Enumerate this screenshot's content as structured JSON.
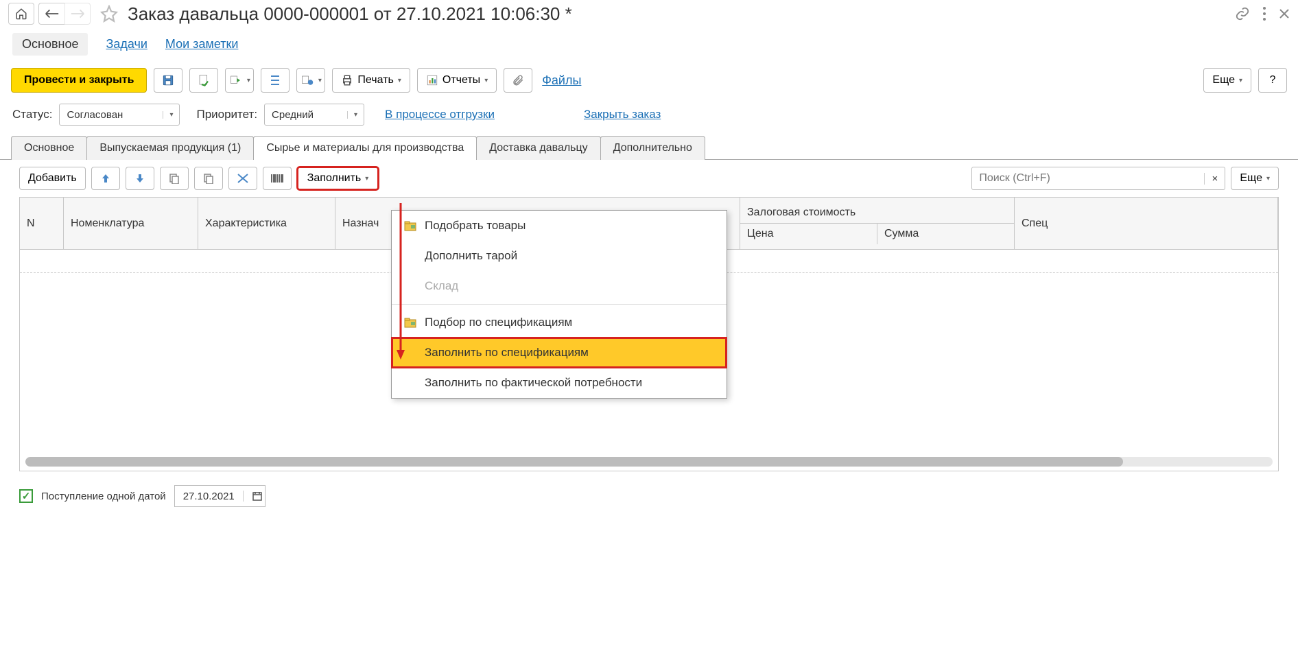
{
  "window": {
    "title": "Заказ давальца 0000-000001 от 27.10.2021 10:06:30 *"
  },
  "nav": {
    "main": "Основное",
    "tasks": "Задачи",
    "notes": "Мои заметки"
  },
  "toolbar": {
    "postClose": "Провести и закрыть",
    "print": "Печать",
    "reports": "Отчеты",
    "files": "Файлы",
    "more": "Еще",
    "help": "?"
  },
  "status": {
    "statusLabel": "Статус:",
    "statusValue": "Согласован",
    "priorityLabel": "Приоритет:",
    "priorityValue": "Средний",
    "shipping": "В процессе отгрузки",
    "closeOrder": "Закрыть заказ"
  },
  "tabs": {
    "main": "Основное",
    "products": "Выпускаемая продукция (1)",
    "materials": "Сырье и материалы для производства",
    "delivery": "Доставка давальцу",
    "extra": "Дополнительно"
  },
  "subbar": {
    "add": "Добавить",
    "fill": "Заполнить",
    "searchPlaceholder": "Поиск (Ctrl+F)",
    "more": "Еще"
  },
  "dropdown": {
    "pickGoods": "Подобрать товары",
    "addTare": "Дополнить тарой",
    "warehouse": "Склад",
    "pickBySpec": "Подбор по спецификациям",
    "fillBySpec": "Заполнить по спецификациям",
    "fillByNeed": "Заполнить по фактической потребности"
  },
  "table": {
    "n": "N",
    "nomenclature": "Номенклатура",
    "characteristic": "Характеристика",
    "purpose": "Назнач",
    "collateral": "Залоговая стоимость",
    "price": "Цена",
    "sum": "Сумма",
    "spec": "Спец"
  },
  "bottom": {
    "singleDate": "Поступление одной датой",
    "dateVal": "27.10.2021"
  }
}
